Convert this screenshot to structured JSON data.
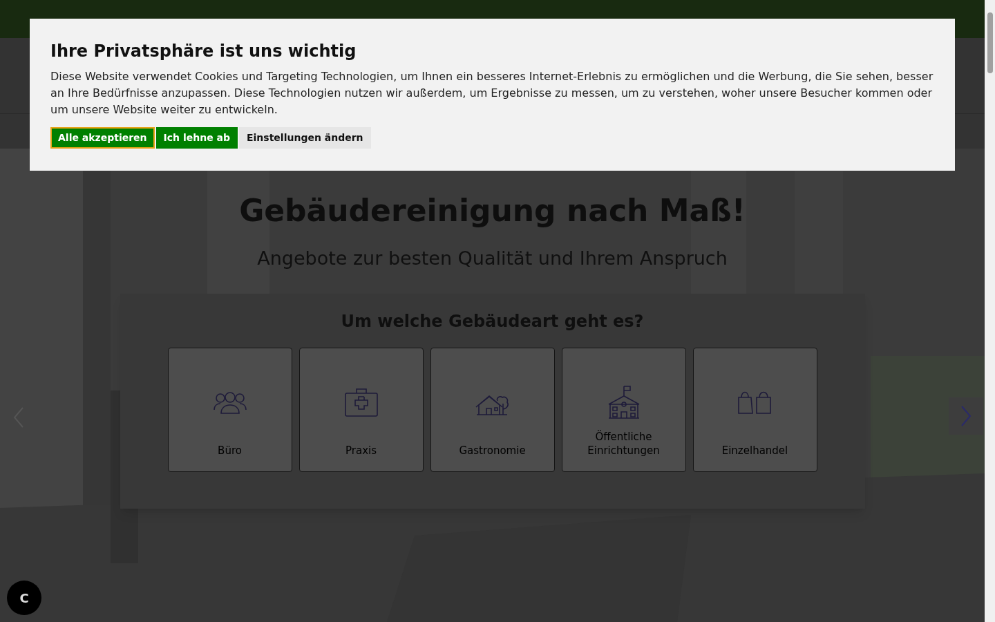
{
  "hero": {
    "title": "Gebäudereinigung nach Maß!",
    "subtitle": "Angebote zur besten Qualität und Ihrem Anspruch",
    "question": "Um welche Gebäudeart geht es?",
    "options": [
      {
        "kind": "people",
        "label": "Büro"
      },
      {
        "kind": "medical",
        "label": "Praxis"
      },
      {
        "kind": "house",
        "label": "Gastronomie"
      },
      {
        "kind": "school",
        "label": "Öffentliche Einrichtungen"
      },
      {
        "kind": "bags",
        "label": "Einzelhandel"
      }
    ]
  },
  "chat_button": {
    "label": "C"
  },
  "cookie_dialog": {
    "title": "Ihre Privatsphäre ist uns wichtig",
    "text": "Diese Website verwendet Cookies und Targeting Technologien, um Ihnen ein besseres Internet-Erlebnis zu ermöglichen und die Werbung, die Sie sehen, besser an Ihre Bedürfnisse anzupassen. Diese Technologien nutzen wir außerdem, um Ergebnisse zu messen, um zu verstehen, woher unsere Besucher kommen oder um unsere Website weiter zu entwickeln.",
    "buttons": [
      {
        "kind": "primary",
        "label": "Alle akzeptieren",
        "focused": true
      },
      {
        "kind": "primary",
        "label": "Ich lehne ab",
        "focused": false
      },
      {
        "kind": "secondary",
        "label": "Einstellungen ändern",
        "focused": false
      }
    ]
  }
}
